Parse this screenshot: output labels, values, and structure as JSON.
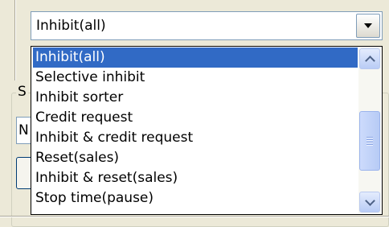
{
  "combo": {
    "value": "Inhibit(all)"
  },
  "dropdown": {
    "items": [
      {
        "label": "Inhibit(all)",
        "selected": true
      },
      {
        "label": "Selective inhibit",
        "selected": false
      },
      {
        "label": "Inhibit sorter",
        "selected": false
      },
      {
        "label": "Credit request",
        "selected": false
      },
      {
        "label": "Inhibit & credit request",
        "selected": false
      },
      {
        "label": "Reset(sales)",
        "selected": false
      },
      {
        "label": "Inhibit & reset(sales)",
        "selected": false
      },
      {
        "label": "Stop time(pause)",
        "selected": false
      }
    ]
  },
  "background": {
    "group_caption": "S",
    "input_value": "N"
  },
  "colors": {
    "selection": "#316ac5",
    "dialog_bg": "#ece9d8",
    "border": "#7f9db9"
  }
}
